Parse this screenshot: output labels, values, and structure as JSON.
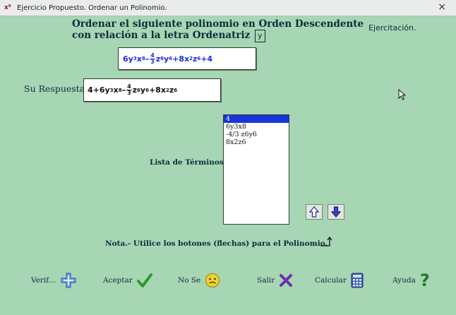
{
  "window": {
    "title": "Ejercicio Propuesto. Ordenar un Polinomio.",
    "close_glyph": "×",
    "icon_text": "x⁸"
  },
  "header": {
    "line1": "Ordenar el siguiente polinomio en Orden Descendente",
    "line2": "con relación a la letra Ordenatriz",
    "variable": "y",
    "mode": "Ejercitación."
  },
  "given_polynomial": {
    "t1": "6y",
    "t1_e1": "3",
    "t1_b2": "x",
    "t1_e2": "8",
    "op1": " – ",
    "frac_num": "4",
    "frac_den": "3",
    "t2_b1": "z",
    "t2_e1": "6",
    "t2_b2": "y",
    "t2_e2": "6",
    "op2": " +8x",
    "t3_e1": "2",
    "t3_b2": "z",
    "t3_e2": "6",
    "op3": " +4"
  },
  "answer": {
    "label": "Su Respuesta:",
    "t0": "4+6y",
    "t0_e1": "3",
    "t0_b2": "x",
    "t0_e2": "8",
    "op1": " – ",
    "frac_num": "4",
    "frac_den": "3",
    "t2_b1": "z",
    "t2_e1": "6",
    "t2_b2": "y",
    "t2_e2": "6",
    "op2": " +8x",
    "t3_e1": "2",
    "t3_b2": "z",
    "t3_e2": "6"
  },
  "terms": {
    "label": "Lista de Términos:",
    "items": [
      "4",
      "6y3x8",
      "-4/3 z6y6",
      "8x2z6"
    ],
    "selected_index": 0
  },
  "note": "Nota.- Utilice los botones (flechas) para  el Polinomio.",
  "buttons": {
    "verif": "Verif...",
    "aceptar": "Aceptar",
    "nose": "No Se",
    "salir": "Salir",
    "calcular": "Calcular",
    "ayuda": "Ayuda",
    "ayuda_glyph": "?"
  },
  "colors": {
    "background": "#a6d6b3",
    "given_text": "#1b2fd1",
    "selection": "#1735d8"
  },
  "icons": [
    "cross-puzzle-icon",
    "checkmark-icon",
    "smiley-icon",
    "x-icon",
    "calculator-icon",
    "question-icon",
    "arrow-up-icon",
    "arrow-down-icon",
    "corner-arrow-icon",
    "mouse-cursor-icon"
  ]
}
